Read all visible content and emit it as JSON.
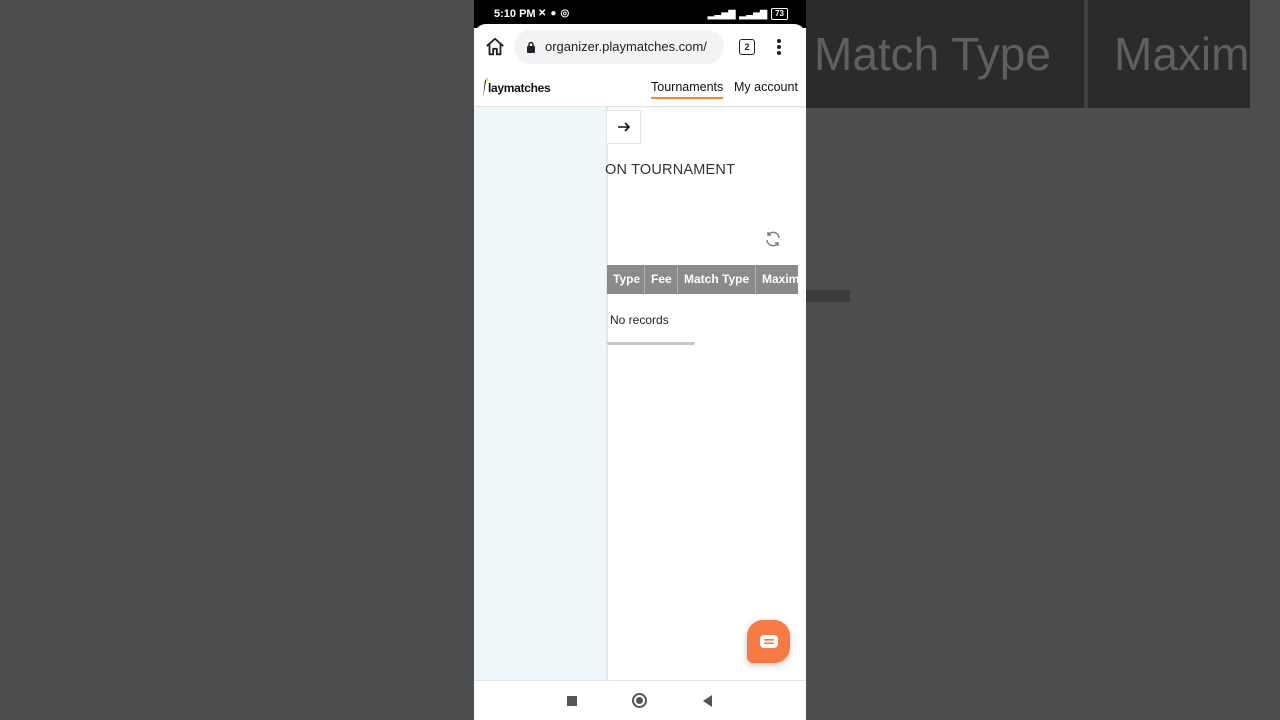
{
  "background": {
    "header_cells": [
      "Match Type",
      "Maxim"
    ]
  },
  "statusbar": {
    "time": "5:10 PM",
    "battery": "73"
  },
  "browser": {
    "url": "organizer.playmatches.com/",
    "tab_count": "2"
  },
  "appnav": {
    "logo": "laymatches",
    "tournaments": "Tournaments",
    "my_account": "My account"
  },
  "main": {
    "title": "ON TOURNAMENT",
    "table": {
      "columns": [
        "Type",
        "Fee",
        "Match Type",
        "Maxim"
      ],
      "empty_text": "No records"
    }
  },
  "colors": {
    "accent": "#f0883a",
    "chat_button": "#f57a43",
    "table_header": "#8a8a8a",
    "sidebar": "#eff7fb"
  }
}
